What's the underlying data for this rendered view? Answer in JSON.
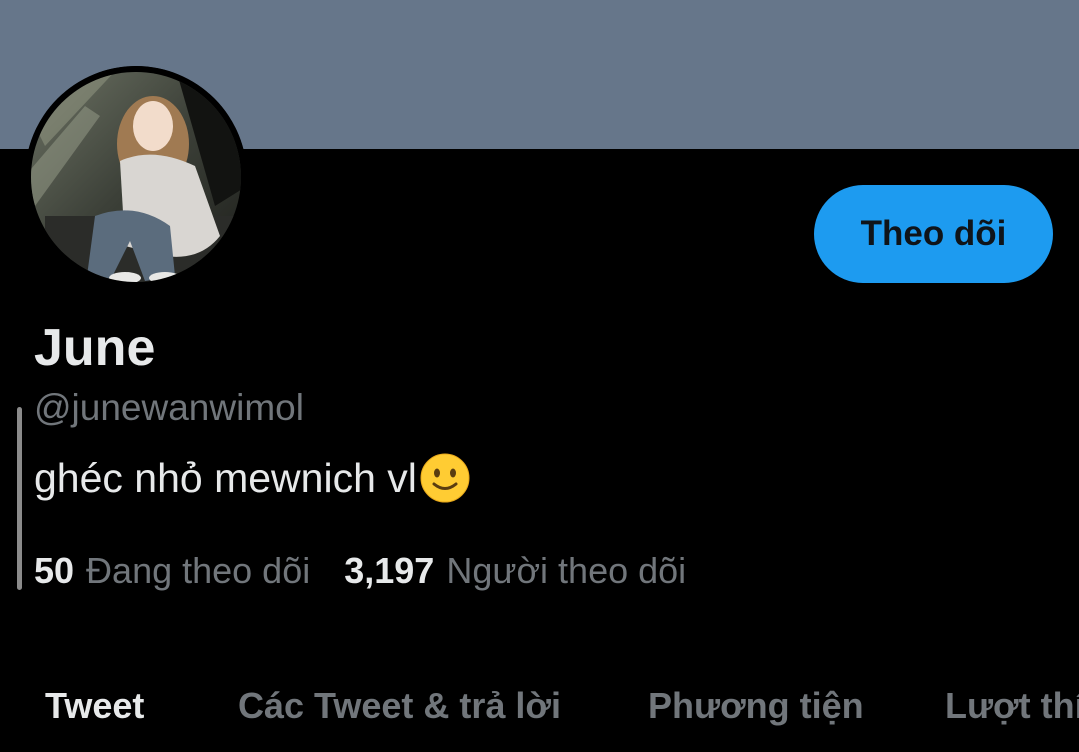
{
  "profile": {
    "display_name": "June",
    "handle": "@junewanwimol",
    "bio": "ghéc nhỏ mewnich vl",
    "bio_emoji": "slightly-smiling-face-icon",
    "follow_label": "Theo dõi"
  },
  "stats": {
    "following_count": "50",
    "following_label": "Đang theo dõi",
    "followers_count": "3,197",
    "followers_label": "Người theo dõi"
  },
  "tabs": [
    {
      "label": "Tweet",
      "active": true
    },
    {
      "label": "Các Tweet & trả lời",
      "active": false
    },
    {
      "label": "Phương tiện",
      "active": false
    },
    {
      "label": "Lượt thí",
      "active": false
    }
  ],
  "colors": {
    "banner": "#66768a",
    "background": "#000000",
    "accent": "#1d9bf0",
    "primary_text": "#e7e9ea",
    "secondary_text": "#71767b"
  }
}
